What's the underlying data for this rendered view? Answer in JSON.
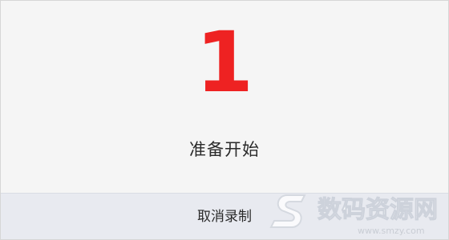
{
  "dialog": {
    "countdown_value": "1",
    "status_text": "准备开始",
    "cancel_label": "取消录制"
  },
  "watermark": {
    "text": "数码资源网",
    "url": "www.smzy.com"
  },
  "colors": {
    "countdown": "#ee2222",
    "background": "#f5f5f5",
    "footer": "#e8eaf0"
  }
}
